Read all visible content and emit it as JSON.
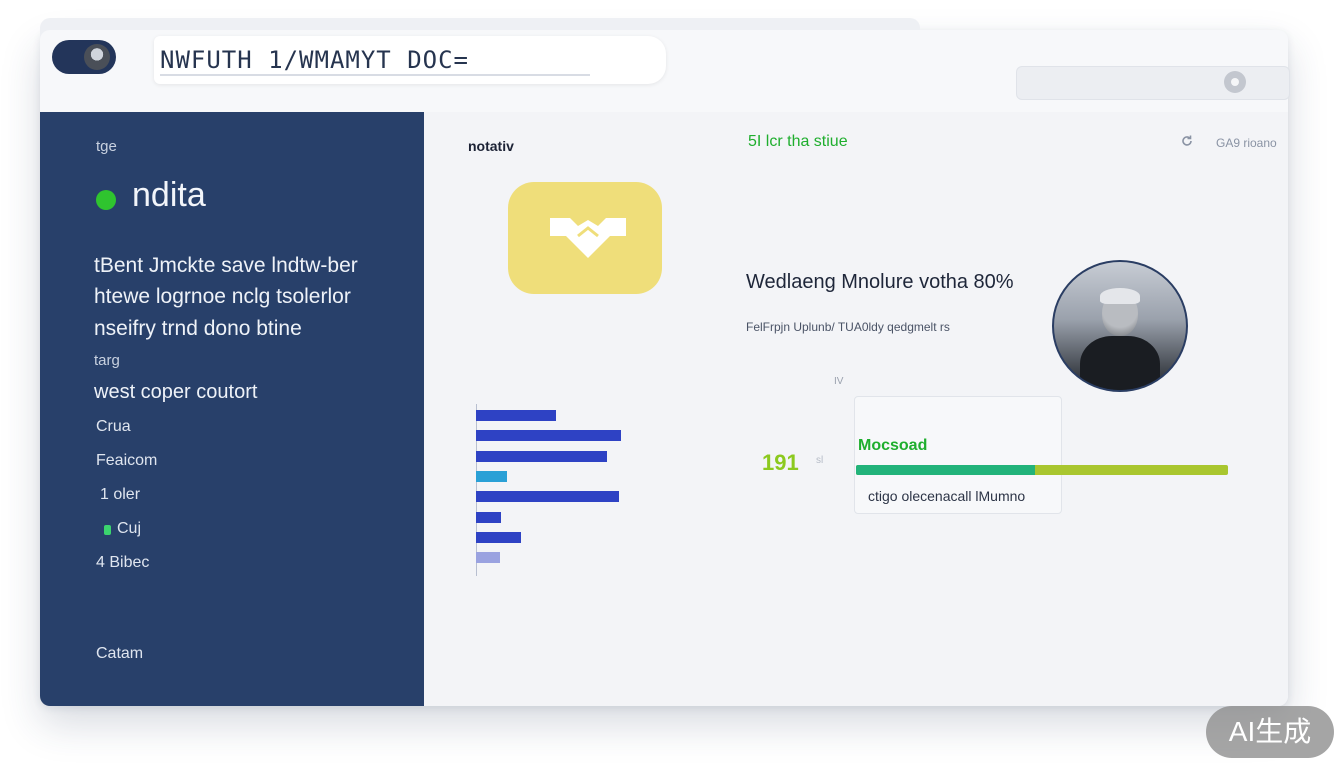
{
  "window": {
    "title": "NWFUTH 1/WMAMYT DOC="
  },
  "sidebar": {
    "label_top": "tge",
    "heading": "ndita",
    "description_lines": [
      "tBent Jmckte save lndtw-ber",
      "htewe logrnoe nclg tsolerlor",
      "nseifry trnd dono btine"
    ],
    "small_label": "targ",
    "subheading": "west coper coutort",
    "items": [
      {
        "label": "Crua"
      },
      {
        "label": "Feaicom"
      },
      {
        "label": "1  oler"
      },
      {
        "label": "Cuj"
      },
      {
        "label": "4  Bibec"
      }
    ],
    "footer": "Catam"
  },
  "main": {
    "section_title": "notativ",
    "status_link": "5I lcr tha stiue",
    "top_right_label": "GA9 rioano",
    "headline": "Wedlaeng Mnolure votha 80%",
    "subline": "FelFrpjn Uplunb/ TUA0ldy qedgmelt rs",
    "small_marker": "IV",
    "stat_value": "191",
    "stat_caption": "sl",
    "card_title": "Mocsoad",
    "card_caption": "ctigo olecenacall lMumno",
    "progress_fraction": 0.48
  },
  "chart_data": {
    "type": "bar",
    "orientation": "horizontal",
    "categories": [],
    "values": [
      80,
      145,
      131,
      31,
      143,
      25,
      45,
      24
    ],
    "colors": [
      "#2e42c4",
      "#2e42c4",
      "#2e42c4",
      "#2aa0d6",
      "#2e42c4",
      "#2e42c4",
      "#2e42c4",
      "#9aa2e0"
    ],
    "xlim": [
      0,
      150
    ],
    "title": "",
    "xlabel": "",
    "ylabel": ""
  },
  "colors": {
    "sidebar_bg": "#28406a",
    "accent_green": "#22b03a",
    "card_yellow": "#efde7a",
    "bar_blue": "#2e42c4",
    "progress_green": "#22b37a",
    "progress_lime": "#a9c62f"
  },
  "icons": {
    "app": "user-avatar-icon",
    "card": "handshake-icon",
    "refresh": "refresh-icon",
    "address": "circle-dot-icon"
  },
  "watermark": "AI生成"
}
